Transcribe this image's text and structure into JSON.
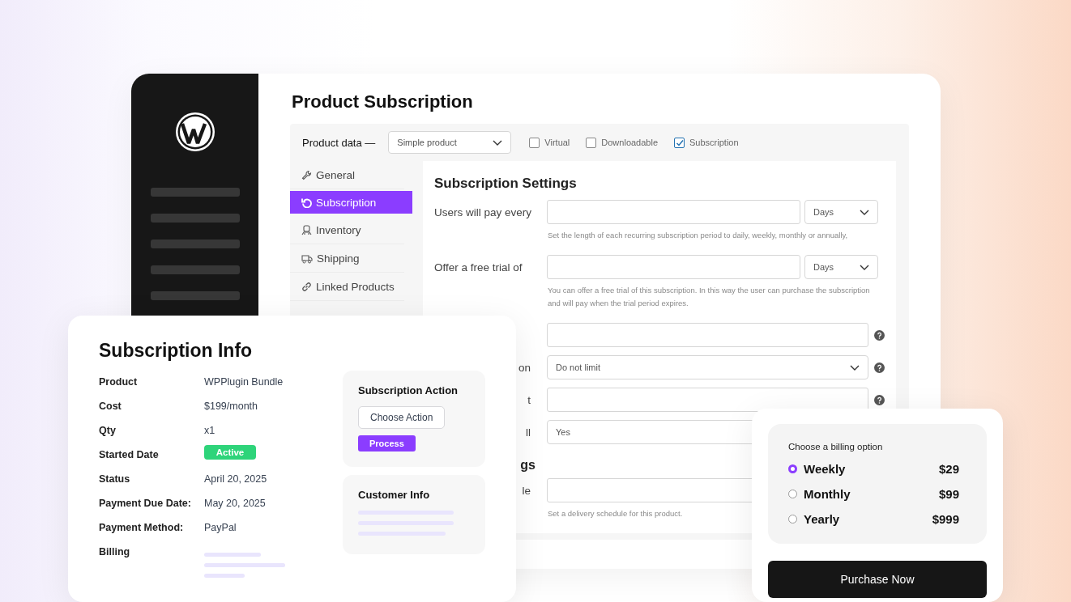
{
  "main_window": {
    "title": "Product Subscription",
    "product_data": {
      "label": "Product data —",
      "type_select": "Simple product",
      "options": [
        {
          "label": "Virtual",
          "checked": false
        },
        {
          "label": "Downloadable",
          "checked": false
        },
        {
          "label": "Subscription",
          "checked": true
        }
      ]
    },
    "tabs": [
      {
        "label": "General",
        "selected": false
      },
      {
        "label": "Subscription",
        "selected": true
      },
      {
        "label": "Inventory",
        "selected": false
      },
      {
        "label": "Shipping",
        "selected": false
      },
      {
        "label": "Linked Products",
        "selected": false
      }
    ],
    "section_title": "Subscription Settings",
    "fields": [
      {
        "kind": "pair",
        "label": "Users will pay every",
        "unit": "Days",
        "help": "Set the length of each recurring subscription period to daily, weekly, monthly or annually,"
      },
      {
        "kind": "pair",
        "label": "Offer a free trial of",
        "unit": "Days",
        "help": "You can offer a free trial of this subscription. In this way the user can purchase the subscription and will pay when the trial period expires."
      },
      {
        "kind": "input",
        "info": true
      },
      {
        "kind": "select",
        "label": "on",
        "value": "Do not limit",
        "info": true
      },
      {
        "kind": "input",
        "label": "t",
        "info": true
      },
      {
        "kind": "filled",
        "label": "ll",
        "value": "Yes"
      },
      {
        "kind": "heading",
        "label": "gs"
      },
      {
        "kind": "input",
        "label": "le",
        "help": "Set a delivery schedule for this product."
      }
    ]
  },
  "info_card": {
    "title": "Subscription Info",
    "rows": [
      {
        "kind": "text",
        "label": "Product",
        "value": "WPPlugin Bundle"
      },
      {
        "kind": "text",
        "label": "Cost",
        "value": "$199/month"
      },
      {
        "kind": "text",
        "label": "Qty",
        "value": "x1"
      },
      {
        "kind": "badge",
        "label": "Started Date",
        "value": "Active"
      },
      {
        "kind": "text",
        "label": "Status",
        "value": "April 20, 2025"
      },
      {
        "kind": "text",
        "label": "Payment Due Date:",
        "value": "May 20, 2025"
      },
      {
        "kind": "text",
        "label": "Payment Method:",
        "value": "PayPal"
      },
      {
        "kind": "lines",
        "label": "Billing"
      }
    ],
    "action": {
      "title": "Subscription Action",
      "select": "Choose Action",
      "button": "Process"
    },
    "customer": {
      "title": "Customer Info"
    }
  },
  "billing_card": {
    "title": "Choose a billing option",
    "options": [
      {
        "label": "Weekly",
        "price": "$29",
        "selected": true
      },
      {
        "label": "Monthly",
        "price": "$99",
        "selected": false
      },
      {
        "label": "Yearly",
        "price": "$999",
        "selected": false
      }
    ],
    "button": "Purchase Now"
  }
}
